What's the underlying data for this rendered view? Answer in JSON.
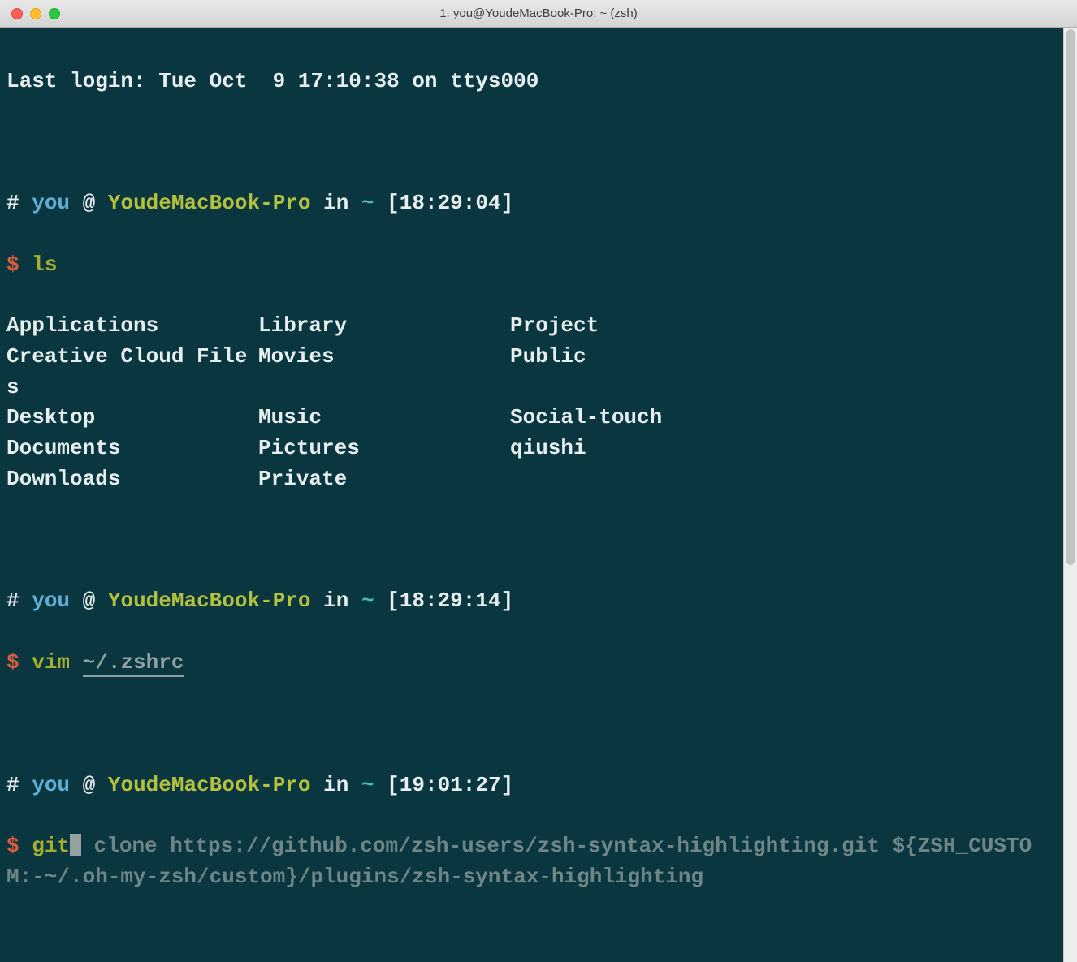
{
  "window": {
    "title": "1. you@YoudeMacBook-Pro: ~ (zsh)"
  },
  "motd": "Last login: Tue Oct  9 17:10:38 on ttys000",
  "prompt1": {
    "hash": "#",
    "user": "you",
    "at": "@",
    "host": "YoudeMacBook-Pro",
    "in": "in",
    "path": "~",
    "time": "[18:29:04]",
    "dollar": "$",
    "command": "ls"
  },
  "ls_output": {
    "col1": [
      "Applications",
      "Creative Cloud Files",
      "Desktop",
      "Documents",
      "Downloads"
    ],
    "col2": [
      "Library",
      "Movies",
      "Music",
      "Pictures",
      "Private"
    ],
    "col3": [
      "Project",
      "Public",
      "Social-touch",
      "qiushi",
      ""
    ]
  },
  "prompt2": {
    "hash": "#",
    "user": "you",
    "at": "@",
    "host": "YoudeMacBook-Pro",
    "in": "in",
    "path": "~",
    "time": "[18:29:14]",
    "dollar": "$",
    "command": "vim",
    "arg": "~/.zshrc"
  },
  "prompt3": {
    "hash": "#",
    "user": "you",
    "at": "@",
    "host": "YoudeMacBook-Pro",
    "in": "in",
    "path": "~",
    "time": "[19:01:27]",
    "dollar": "$",
    "typed": "git",
    "suggestion": " clone https://github.com/zsh-users/zsh-syntax-highlighting.git ${ZSH_CUSTOM:-~/.oh-my-zsh/custom}/plugins/zsh-syntax-highlighting"
  }
}
